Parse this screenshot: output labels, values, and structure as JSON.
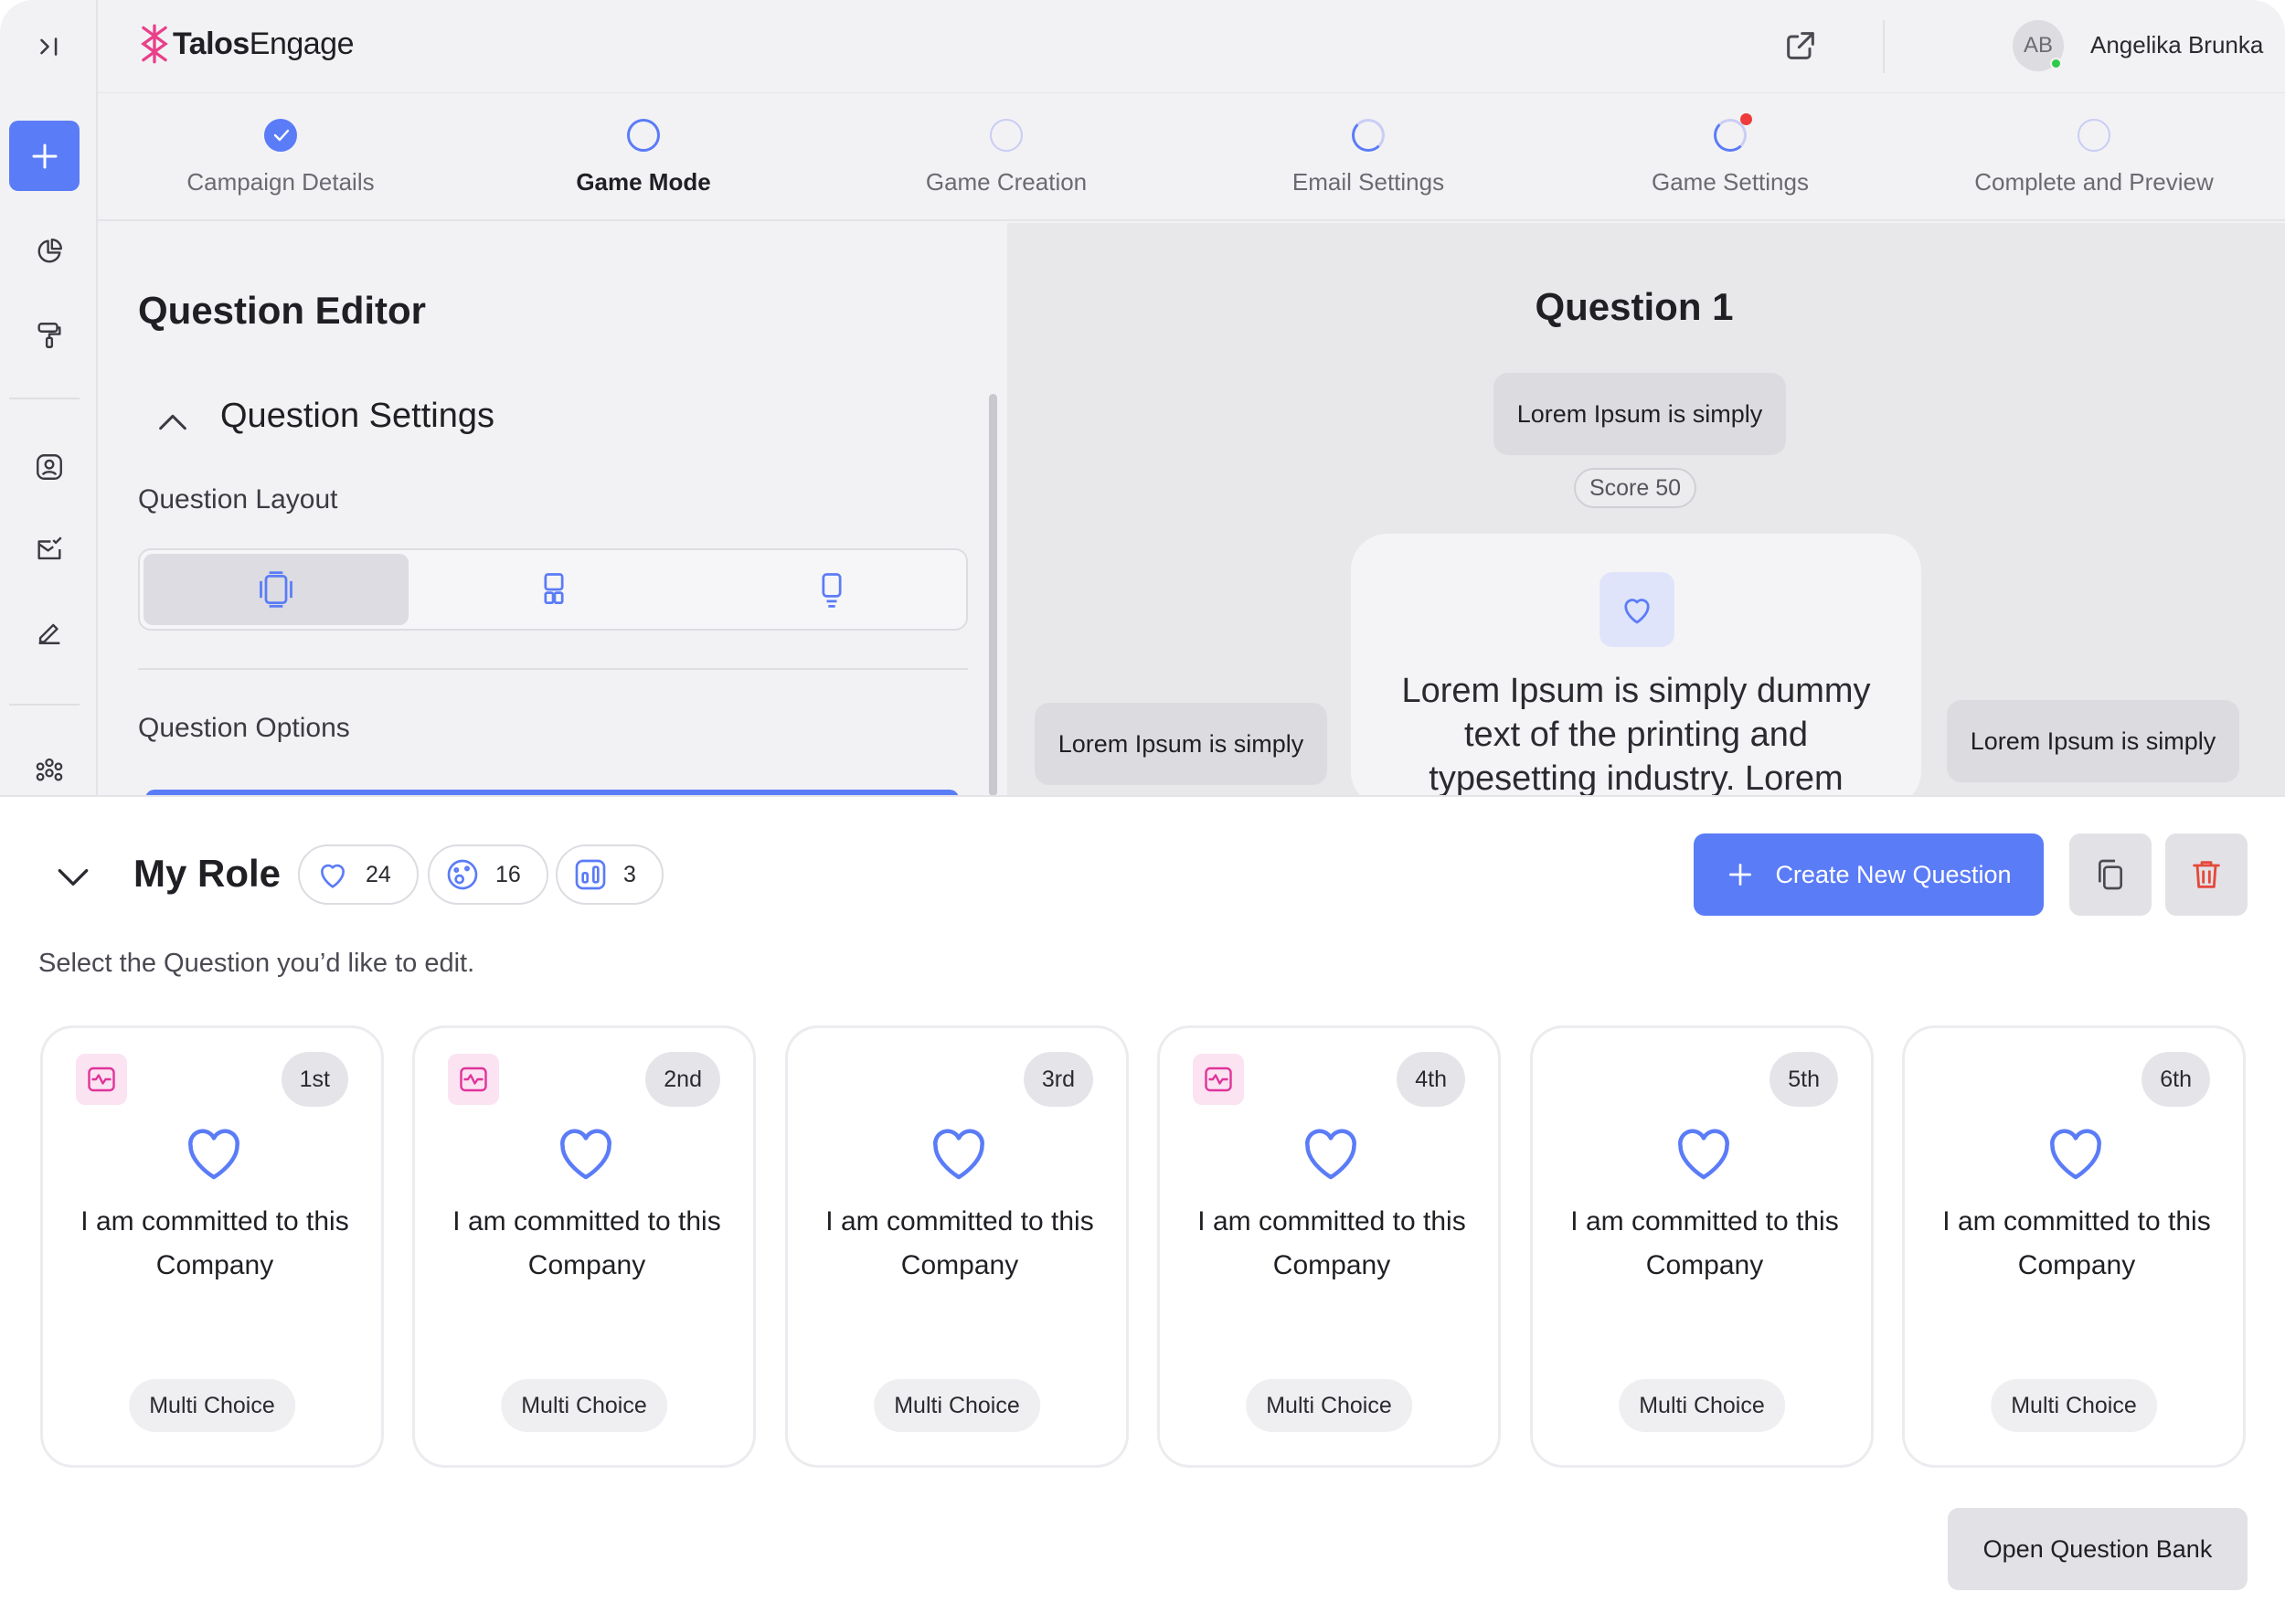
{
  "brand": {
    "name_bold": "Talos",
    "name_light": "Engage",
    "accent": "#5b7cf7",
    "logo_color": "#e8408a"
  },
  "user": {
    "initials": "AB",
    "name": "Angelika Brunka",
    "status": "online"
  },
  "sidebar": {
    "items": [
      {
        "icon": "collapse-sidebar-icon"
      },
      {
        "icon": "plus-icon"
      },
      {
        "icon": "pie-chart-icon"
      },
      {
        "icon": "paint-roller-icon"
      },
      {
        "icon": "user-profile-icon"
      },
      {
        "icon": "mail-check-icon"
      },
      {
        "icon": "pen-icon"
      },
      {
        "icon": "group-icon"
      }
    ]
  },
  "stepper": {
    "steps": [
      {
        "label": "Campaign Details",
        "state": "done"
      },
      {
        "label": "Game Mode",
        "state": "active"
      },
      {
        "label": "Game Creation",
        "state": "pending"
      },
      {
        "label": "Email Settings",
        "state": "partial"
      },
      {
        "label": "Game Settings",
        "state": "partial-alert"
      },
      {
        "label": "Complete and Preview",
        "state": "pending"
      }
    ]
  },
  "editor": {
    "title": "Question Editor",
    "settings_title": "Question Settings",
    "layout_label": "Question Layout",
    "layout_options": [
      "layout-full-icon",
      "layout-grid-icon",
      "layout-single-icon"
    ],
    "options_label": "Question Options"
  },
  "preview": {
    "title": "Question 1",
    "top_answer": "Lorem Ipsum is simply",
    "score": "Score 50",
    "left_answer": "Lorem Ipsum is simply",
    "right_answer": "Lorem Ipsum is simply",
    "question_text": "Lorem Ipsum is simply dummy text of the printing and typesetting industry. Lorem"
  },
  "role": {
    "title": "My Role",
    "stats": [
      {
        "icon": "heart-icon",
        "value": "24"
      },
      {
        "icon": "palette-icon",
        "value": "16"
      },
      {
        "icon": "bar-chart-icon",
        "value": "3"
      }
    ],
    "create_label": "Create New Question",
    "hint": "Select the Question you’d like to edit.",
    "bank_label": "Open Question Bank"
  },
  "questions": [
    {
      "rank": "1st",
      "text": "I am committed to this Company",
      "type": "Multi Choice",
      "flag": true
    },
    {
      "rank": "2nd",
      "text": "I am committed to this Company",
      "type": "Multi Choice",
      "flag": true
    },
    {
      "rank": "3rd",
      "text": "I am committed to this Company",
      "type": "Multi Choice",
      "flag": false
    },
    {
      "rank": "4th",
      "text": "I am committed to this Company",
      "type": "Multi Choice",
      "flag": true
    },
    {
      "rank": "5th",
      "text": "I am committed to this Company",
      "type": "Multi Choice",
      "flag": false
    },
    {
      "rank": "6th",
      "text": "I am committed to this Company",
      "type": "Multi Choice",
      "flag": false
    }
  ]
}
